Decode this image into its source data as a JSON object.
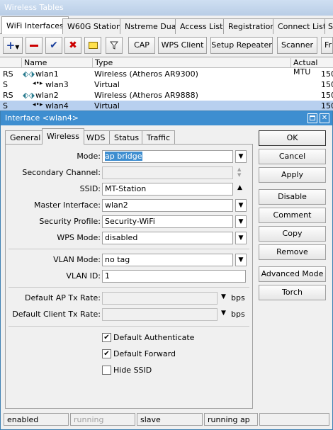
{
  "outer": {
    "title": "Wireless Tables",
    "tabs": [
      "WiFi Interfaces",
      "W60G Station",
      "Nstreme Dual",
      "Access List",
      "Registration",
      "Connect List",
      "S"
    ],
    "toolbar": {
      "cap": "CAP",
      "wps_client": "WPS Client",
      "setup_repeater": "Setup Repeater",
      "scanner": "Scanner",
      "fr": "Fr"
    },
    "columns": {
      "name": "Name",
      "type": "Type",
      "mtu": "Actual MTU"
    },
    "rows": [
      {
        "flag": "RS",
        "name": "wlan1",
        "type": "Wireless (Atheros AR9300)",
        "mtu": "150"
      },
      {
        "flag": "S",
        "name": "wlan3",
        "type": "Virtual",
        "mtu": "150"
      },
      {
        "flag": "RS",
        "name": "wlan2",
        "type": "Wireless (Atheros AR9888)",
        "mtu": "150"
      },
      {
        "flag": "S",
        "name": "wlan4",
        "type": "Virtual",
        "mtu": "150"
      }
    ]
  },
  "dialog": {
    "title": "Interface <wlan4>",
    "tabs": [
      "General",
      "Wireless",
      "WDS",
      "Status",
      "Traffic"
    ],
    "fields": {
      "mode_label": "Mode:",
      "mode_value": "ap bridge",
      "secondary_channel_label": "Secondary Channel:",
      "ssid_label": "SSID:",
      "ssid_value": "MT-Station",
      "master_interface_label": "Master Interface:",
      "master_interface_value": "wlan2",
      "security_profile_label": "Security Profile:",
      "security_profile_value": "Security-WiFi",
      "wps_mode_label": "WPS Mode:",
      "wps_mode_value": "disabled",
      "vlan_mode_label": "VLAN Mode:",
      "vlan_mode_value": "no tag",
      "vlan_id_label": "VLAN ID:",
      "vlan_id_value": "1",
      "ap_tx_rate_label": "Default AP Tx Rate:",
      "ap_tx_rate_unit": "bps",
      "client_tx_rate_label": "Default Client Tx Rate:",
      "client_tx_rate_unit": "bps"
    },
    "checkboxes": {
      "default_authenticate": "Default Authenticate",
      "default_forward": "Default Forward",
      "hide_ssid": "Hide SSID"
    },
    "buttons": {
      "ok": "OK",
      "cancel": "Cancel",
      "apply": "Apply",
      "disable": "Disable",
      "comment": "Comment",
      "copy": "Copy",
      "remove": "Remove",
      "advanced_mode": "Advanced Mode",
      "torch": "Torch"
    },
    "status": [
      "enabled",
      "running",
      "slave",
      "running ap"
    ]
  }
}
